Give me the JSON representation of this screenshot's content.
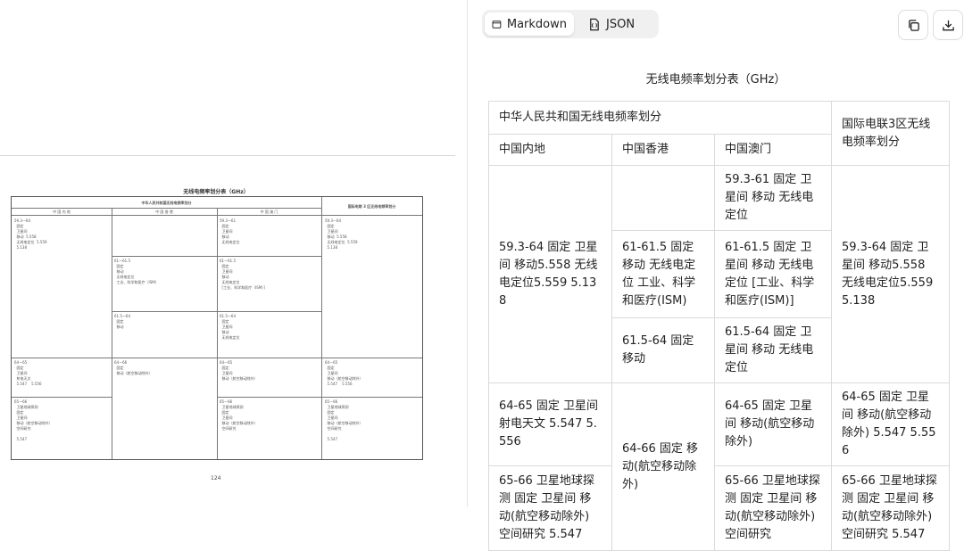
{
  "toolbar": {
    "tabs": [
      {
        "label": "Markdown",
        "icon": "document-icon",
        "active": true
      },
      {
        "label": "JSON",
        "icon": "json-file-icon",
        "active": false
      }
    ],
    "actions": [
      {
        "name": "copy",
        "icon": "copy-icon"
      },
      {
        "name": "download",
        "icon": "download-icon"
      }
    ]
  },
  "result": {
    "title": "无线电频率划分表（GHz）",
    "header": {
      "group": "中华人民共和国无线电频率划分",
      "itu": "国际电联3区无线电频率划分",
      "mainland": "中国内地",
      "hongkong": "中国香港",
      "macau": "中国澳门"
    },
    "cells": {
      "mo_59": "59.3-61 固定 卫星间 移动 无线电定位",
      "ml_59": "59.3-64 固定 卫星间 移动5.558 无线电定位5.559 5.138",
      "itu_59": "59.3-64 固定 卫星间 移动5.558 无线电定位5.559 5.138",
      "hk_61": "61-61.5 固定 移动 无线电定位 工业、科学和医疗(ISM)",
      "mo_61": "61-61.5 固定 卫星间 移动 无线电定位 [工业、科学和医疗(ISM)]",
      "hk_615": "61.5-64 固定 移动",
      "mo_615": "61.5-64 固定 卫星间 移动 无线电定位",
      "ml_64": "64-65 固定 卫星间 射电天文 5.547 5.556",
      "hk_64": "64-66 固定 移动(航空移动除外)",
      "mo_64": "64-65 固定 卫星间 移动(航空移动除外)",
      "itu_64": "64-65 固定 卫星间 移动(航空移动除外) 5.547 5.556",
      "ml_65": "65-66 卫星地球探测 固定 卫星间 移动(航空移动除外) 空间研究 5.547",
      "mo_65": "65-66 卫星地球探测 固定 卫星间 移动(航空移动除外) 空间研究",
      "itu_65": "65-66 卫星地球探测 固定 卫星间 移动(航空移动除外) 空间研究 5.547"
    }
  },
  "source_page": {
    "title": "无线电频率划分表（GHz）",
    "group_header": "中华人民共和国无线电频率划分",
    "itu_header": "国际电联 3 区无线电频率划分",
    "col_headers": [
      "中 国 内 地",
      "中 国 香 港",
      "中 国 澳 门"
    ],
    "ml_59": "59.3—64\n  固定\n  卫星间\n  移动  5.558\n  无线电定位  5.559\n  5.138",
    "mo_59": "59.3—61\n  固定\n  卫星间\n  移动\n  无线电定位",
    "itu_59": "59.3—64\n  固定\n  卫星间\n  移动  5.558\n  无线电定位  5.559\n  5.138",
    "hk_61": "61—61.5\n  固定\n  移动\n  无线电定位\n  工业、科学和医疗（ISM）",
    "mo_61": "61—61.5\n  固定\n  卫星间\n  移动\n  无线电定位\n  [工业、科学和医疗（ISM）]",
    "hk_615": "61.5—64\n  固定\n  移动",
    "mo_615": "61.5—64\n  固定\n  卫星间\n  移动\n  无线电定位",
    "ml_64": "64—65\n  固定\n  卫星间\n  射电天文\n  5.547    5.556",
    "hk_64": "64—66\n  固定\n  移动（航空移动除外）",
    "mo_64": "64—65\n  固定\n  卫星间\n  移动（航空移动除外）",
    "itu_64": "64—65\n  固定\n  卫星间\n  移动（航空移动除外）\n  5.547    5.556",
    "ml_65": "65—66\n  卫星地球探测\n  固定\n  卫星间\n  移动（航空移动除外）\n  空间研究\n\n  5.547",
    "mo_65": "65—66\n  卫星地球探测\n  固定\n  卫星间\n  移动（航空移动除外）\n  空间研究",
    "itu_65": "65—66\n  卫星地球探测\n  固定\n  卫星间\n  移动（航空移动除外）\n  空间研究\n\n  5.547",
    "page_number": "124"
  }
}
